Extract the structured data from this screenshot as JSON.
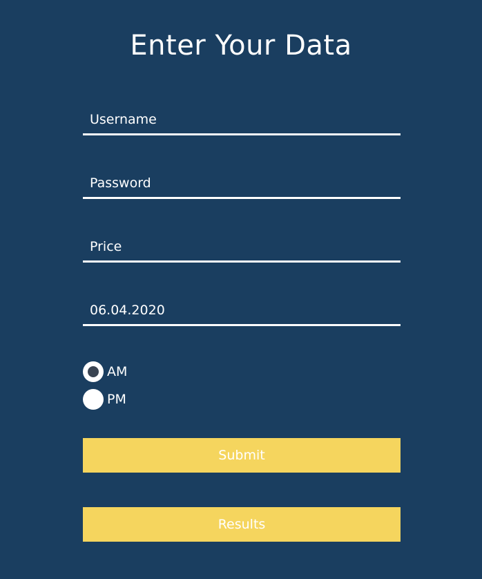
{
  "form": {
    "title": "Enter Your Data",
    "fields": {
      "username": {
        "placeholder": "Username",
        "value": ""
      },
      "password": {
        "placeholder": "Password",
        "value": ""
      },
      "price": {
        "placeholder": "Price",
        "value": ""
      },
      "date": {
        "placeholder": "",
        "value": "06.04.2020"
      }
    },
    "time_of_day": {
      "options": [
        {
          "label": "AM",
          "checked": true
        },
        {
          "label": "PM",
          "checked": false
        }
      ]
    },
    "buttons": {
      "submit_label": "Submit",
      "results_label": "Results"
    }
  },
  "colors": {
    "background": "#1a3e60",
    "text": "#ffffff",
    "button": "#f5d55e",
    "radio_dot": "#3a4452"
  },
  "icons": {
    "radio_selected": "radio-selected-icon",
    "radio_unselected": "radio-unselected-icon"
  }
}
